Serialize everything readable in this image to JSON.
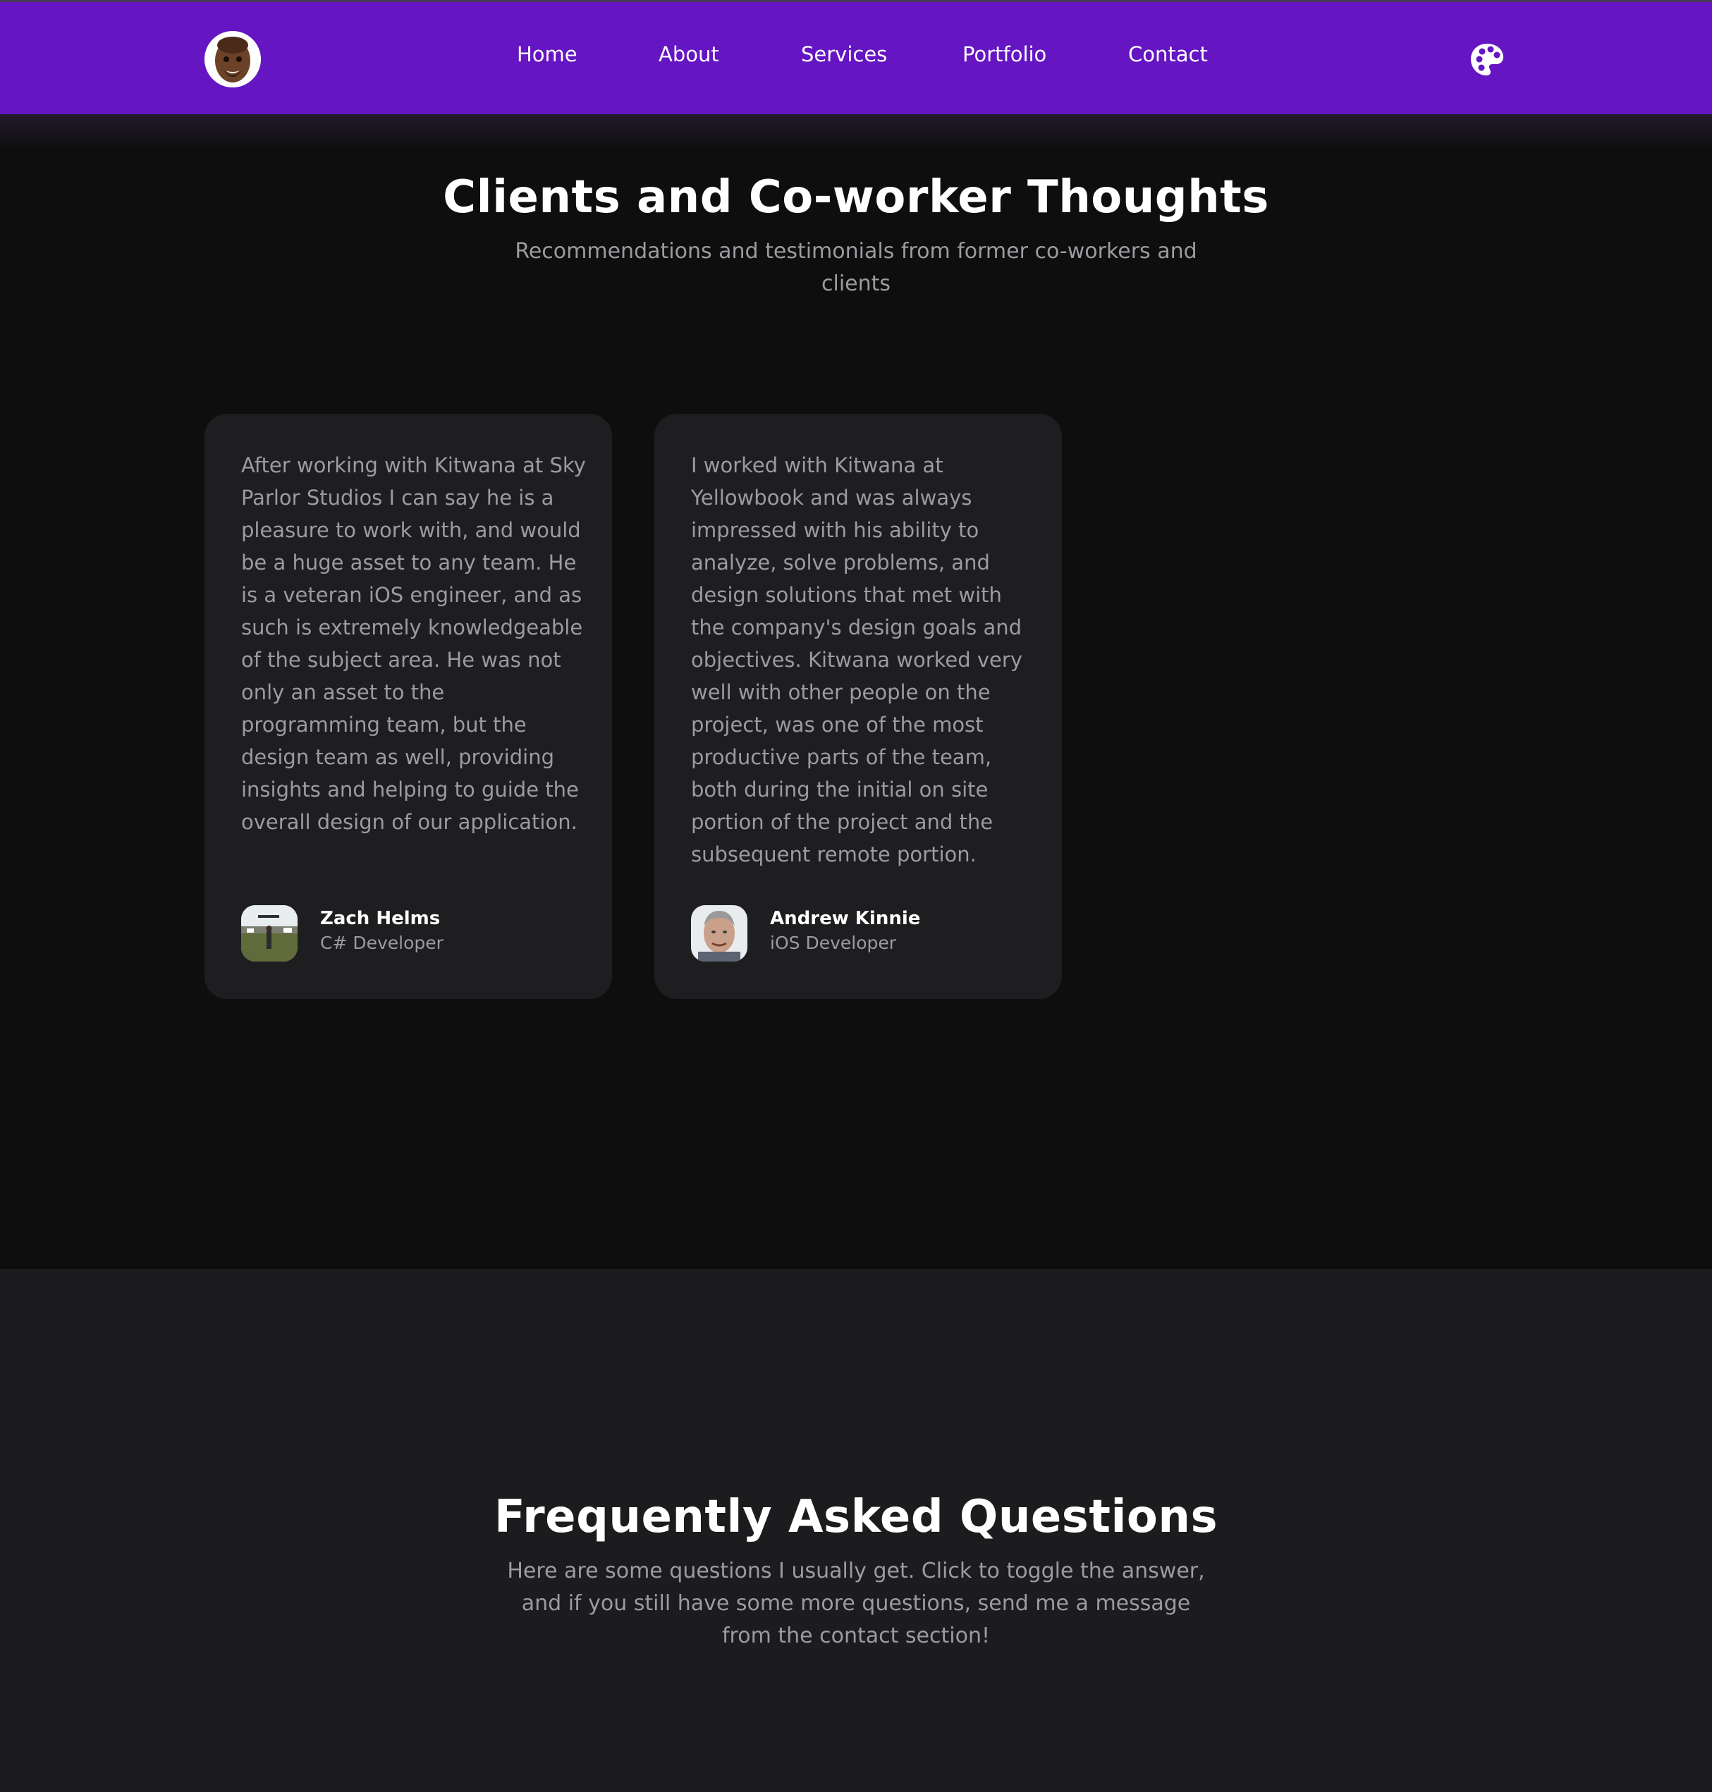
{
  "nav": {
    "links": [
      "Home",
      "About",
      "Services",
      "Portfolio",
      "Contact"
    ],
    "accent_color": "#6515c2",
    "theme_icon": "palette-icon"
  },
  "testimonials": {
    "title": "Clients and Co-worker Thoughts",
    "subtitle_line1": "Recommendations and testimonials from former co-workers and",
    "subtitle_line2": "clients",
    "cards": [
      {
        "text": "After working with Kitwana at Sky Parlor Studios I can say he is a pleasure to work with, and would be a huge asset to any team. He is a veteran iOS engineer, and as such is extremely knowledgeable of the subject area. He was not only an asset to the programming team, but the design team as well, providing insights and helping to guide the overall design of our application.",
        "name": "Zach Helms",
        "role": "C# Developer"
      },
      {
        "text": "I worked with Kitwana at Yellowbook and was always impressed with his ability to analyze, solve problems, and design solutions that met with the company's design goals and objectives. Kitwana worked very well with other people on the project, was one of the most productive parts of the team, both during the initial on site portion of the project and the subsequent remote portion.",
        "name": "Andrew Kinnie",
        "role": "iOS Developer"
      }
    ]
  },
  "faq": {
    "title": "Frequently Asked Questions",
    "subtitle_line1": "Here are some questions I usually get. Click to toggle the answer,",
    "subtitle_line2": "and if you still have some more questions, send me a message",
    "subtitle_line3": "from the contact section!"
  }
}
